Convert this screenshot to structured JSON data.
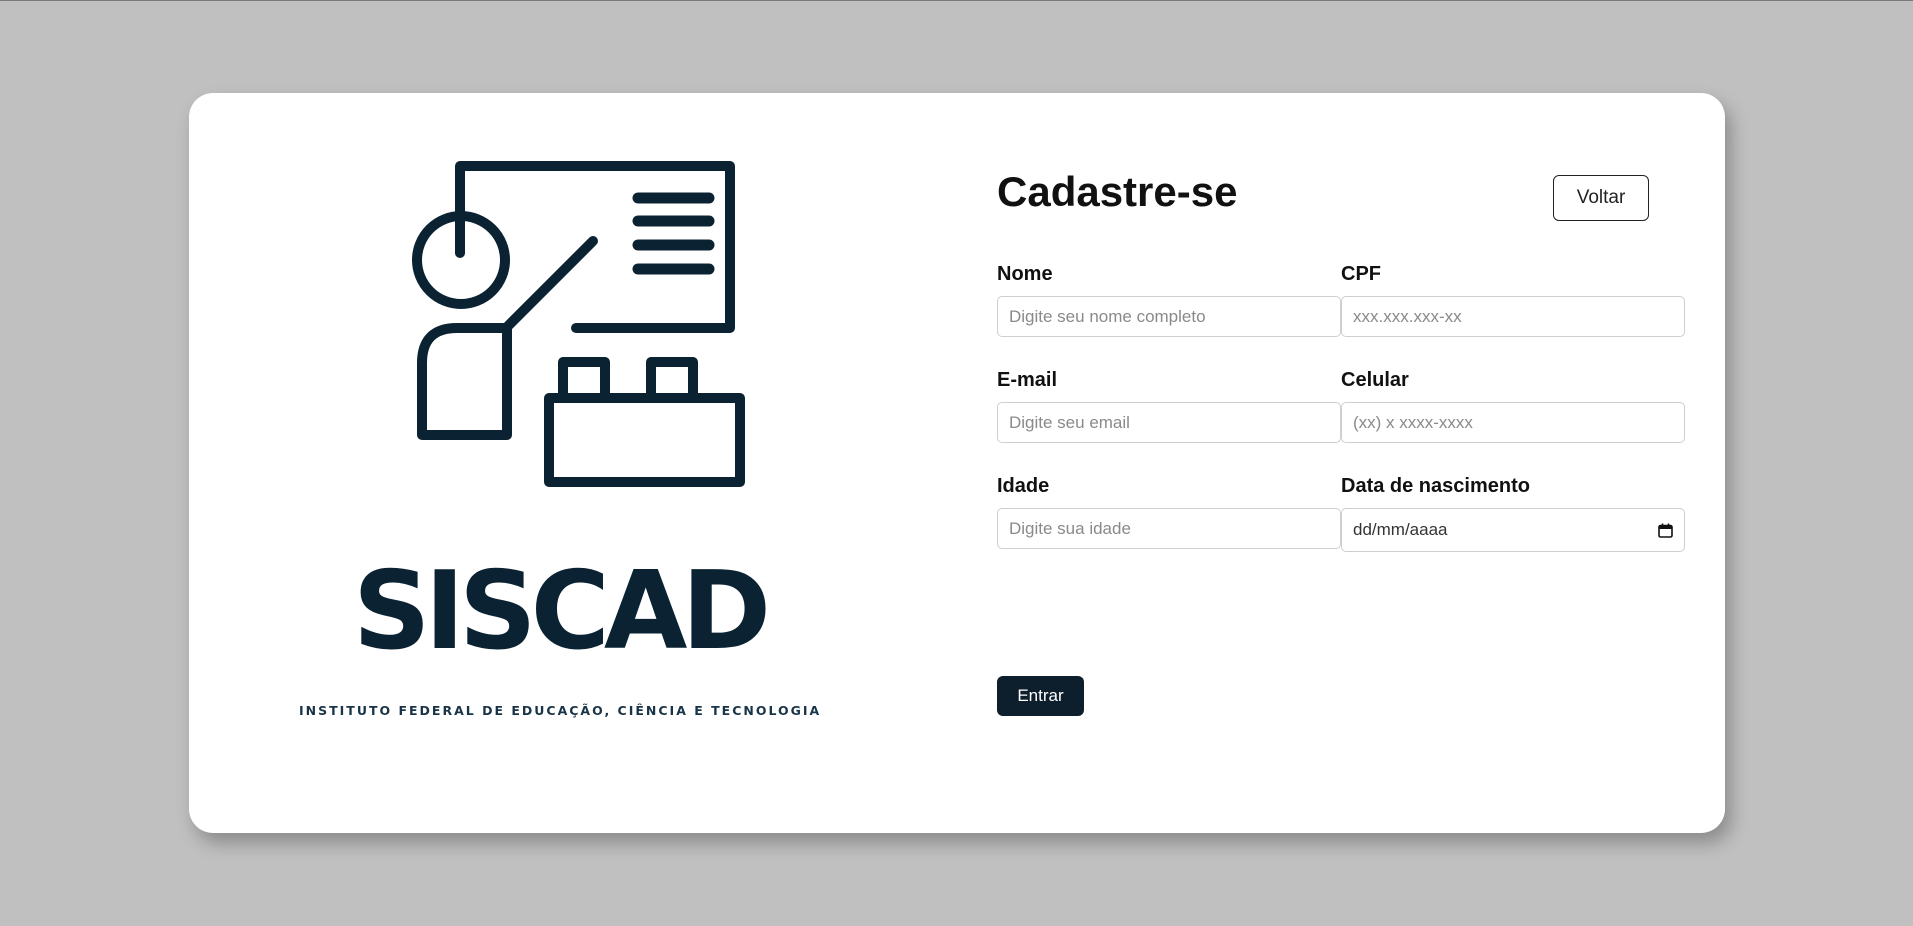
{
  "brand": {
    "name": "SISCAD",
    "tagline": "INSTITUTO FEDERAL DE EDUCAÇÃO, CIÊNCIA E TECNOLOGIA",
    "color": "#0b2233"
  },
  "form": {
    "title": "Cadastre-se",
    "back_label": "Voltar",
    "submit_label": "Entrar",
    "fields": {
      "nome": {
        "label": "Nome",
        "placeholder": "Digite seu nome completo",
        "value": ""
      },
      "cpf": {
        "label": "CPF",
        "placeholder": "xxx.xxx.xxx-xx",
        "value": ""
      },
      "email": {
        "label": "E-mail",
        "placeholder": "Digite seu email",
        "value": ""
      },
      "celular": {
        "label": "Celular",
        "placeholder": "(xx) x xxxx-xxxx",
        "value": ""
      },
      "idade": {
        "label": "Idade",
        "placeholder": "Digite sua idade",
        "value": ""
      },
      "nascimento": {
        "label": "Data de nascimento",
        "placeholder": "dd/mm/aaaa",
        "value": ""
      }
    }
  },
  "icons": {
    "logo": "teacher-board-icon",
    "date": "calendar-icon"
  },
  "colors": {
    "background": "#c0c0c0",
    "card": "#ffffff",
    "accent": "#0d1f2d"
  }
}
